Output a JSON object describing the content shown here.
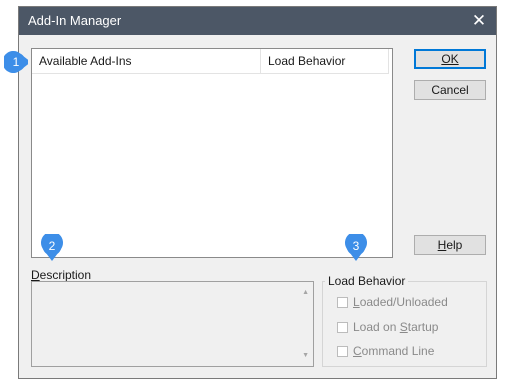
{
  "window": {
    "title": "Add-In Manager",
    "close_glyph": "✕"
  },
  "addins_list": {
    "columns": [
      "Available Add-Ins",
      "Load Behavior"
    ],
    "rows": []
  },
  "buttons": {
    "ok": "OK",
    "cancel": "Cancel",
    "help_first": "H",
    "help_rest": "elp"
  },
  "description": {
    "label_first": "D",
    "label_rest": "escription",
    "text": ""
  },
  "load_behavior": {
    "title": "Load Behavior",
    "options": [
      {
        "first": "L",
        "rest": "oaded/Unloaded",
        "checked": false
      },
      {
        "pre": "Load on ",
        "first": "S",
        "rest": "tartup",
        "checked": false
      },
      {
        "first": "C",
        "rest": "ommand Line",
        "checked": false
      }
    ]
  },
  "callouts": [
    "1",
    "2",
    "3"
  ],
  "colors": {
    "callout": "#3d8ee8",
    "titlebar": "#4c5766",
    "default_button_border": "#0078d7"
  }
}
